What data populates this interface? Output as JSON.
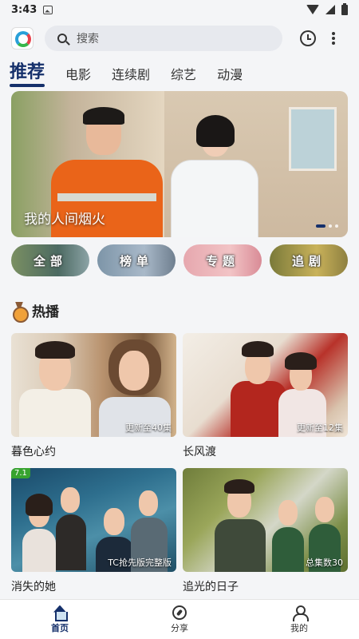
{
  "status_bar": {
    "time": "3:43"
  },
  "header": {
    "search_placeholder": "搜索"
  },
  "tabs": [
    {
      "label": "推荐",
      "active": true
    },
    {
      "label": "电影"
    },
    {
      "label": "连续剧"
    },
    {
      "label": "综艺"
    },
    {
      "label": "动漫"
    }
  ],
  "banner": {
    "caption": "我的人间烟火"
  },
  "categories": [
    {
      "label": "全部"
    },
    {
      "label": "榜单"
    },
    {
      "label": "专题"
    },
    {
      "label": "追剧"
    }
  ],
  "hot": {
    "title": "热播",
    "items": [
      {
        "title": "暮色心约",
        "badge": "更新至40集"
      },
      {
        "title": "长风渡",
        "badge": "更新至12集"
      },
      {
        "title": "消失的她",
        "badge": "TC抢先版完整版",
        "score": "7.1"
      },
      {
        "title": "追光的日子",
        "badge": "总集数30"
      }
    ]
  },
  "bottom_nav": [
    {
      "label": "首页",
      "active": true
    },
    {
      "label": "分享"
    },
    {
      "label": "我的"
    }
  ],
  "colors": {
    "accent": "#15306b",
    "score_badge": "#37a32f"
  }
}
